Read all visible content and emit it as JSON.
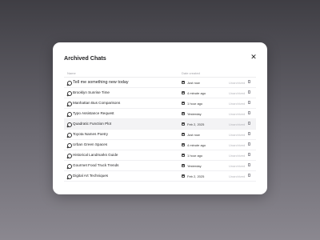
{
  "modal": {
    "title": "Archived Chats",
    "close_icon": "close-icon",
    "columns": {
      "name": "Name",
      "date_created": "Date created"
    },
    "chats": [
      {
        "name": "Tell me something new today",
        "date": "Just now",
        "status": "Unarchived"
      },
      {
        "name": "Brooklyn Sunrise Time",
        "date": "4 minute ago",
        "status": "Unarchived"
      },
      {
        "name": "Manhattan Bus Comparisons",
        "date": "1 hour ago",
        "status": "Unarchived"
      },
      {
        "name": "Typo Assistance Request",
        "date": "Yesterday",
        "status": "Unarchived"
      },
      {
        "name": "Quadratic Function Plot",
        "date": "Feb 2, 2025",
        "status": "Unarchived"
      },
      {
        "name": "Toyota Names Poetry",
        "date": "Just now",
        "status": "Unarchived"
      },
      {
        "name": "Urban Green Spaces",
        "date": "4 minute ago",
        "status": "Unarchived"
      },
      {
        "name": "Historical Landmarks Guide",
        "date": "1 hour ago",
        "status": "Unarchived"
      },
      {
        "name": "Gourmet Food Truck Trends",
        "date": "Yesterday",
        "status": "Unarchived"
      },
      {
        "name": "Digital Art Techniques",
        "date": "Feb 2, 2025",
        "status": "Unarchived"
      }
    ]
  }
}
